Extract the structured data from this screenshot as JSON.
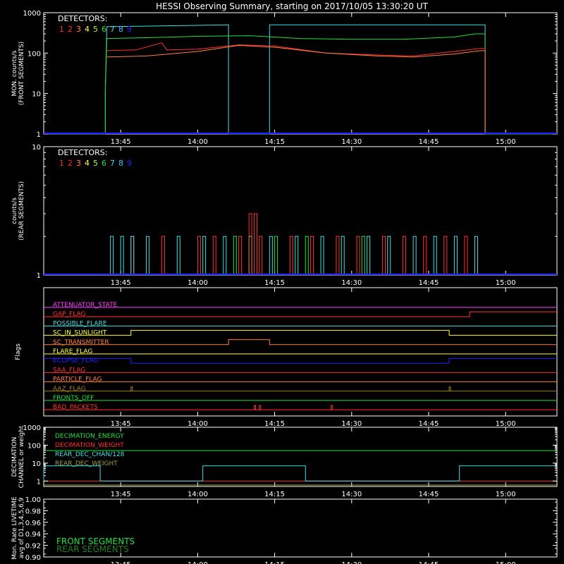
{
  "title": "HESSI Observing Summary, starting on 2017/10/05 13:30:20 UT",
  "time_ticks": [
    "13:45",
    "14:00",
    "14:15",
    "14:30",
    "14:45",
    "15:00"
  ],
  "detectors": {
    "heading": "DETECTORS:",
    "items": [
      {
        "label": "1",
        "color": "#ff3030"
      },
      {
        "label": "2",
        "color": "#ff2020"
      },
      {
        "label": "3",
        "color": "#ff8040"
      },
      {
        "label": "4",
        "color": "#ffff40"
      },
      {
        "label": "5",
        "color": "#a0ff40"
      },
      {
        "label": "6",
        "color": "#20e040"
      },
      {
        "label": "7",
        "color": "#40e0e0"
      },
      {
        "label": "8",
        "color": "#40c0ff"
      },
      {
        "label": "9",
        "color": "#2020ff"
      }
    ]
  },
  "chart_data": [
    {
      "type": "line",
      "name": "front-segment-rates",
      "ylabel": "MON. counts/s (FRONT SEGMENTS)",
      "ylabel_lines": [
        "MON. counts/s",
        "(FRONT SEGMENTS)"
      ],
      "yscale": "log",
      "ylim": [
        1,
        1000
      ],
      "yticks": [
        "1",
        "10",
        "100",
        "1000"
      ],
      "xlim_minutes": [
        0,
        100
      ],
      "series": [
        {
          "color": "#40e0e0",
          "points": [
            [
              0,
              1
            ],
            [
              12,
              1
            ],
            [
              12,
              12
            ],
            [
              12.3,
              450
            ],
            [
              36,
              500
            ],
            [
              36,
              1
            ],
            [
              44,
              1
            ],
            [
              44,
              500
            ],
            [
              86,
              500
            ],
            [
              86,
              1
            ],
            [
              100,
              1
            ]
          ]
        },
        {
          "color": "#20e040",
          "points": [
            [
              12,
              1
            ],
            [
              12,
              12
            ],
            [
              12.3,
              230
            ],
            [
              20,
              240
            ],
            [
              30,
              260
            ],
            [
              40,
              270
            ],
            [
              50,
              230
            ],
            [
              60,
              220
            ],
            [
              70,
              220
            ],
            [
              80,
              250
            ],
            [
              84,
              300
            ],
            [
              86,
              300
            ],
            [
              86,
              1
            ],
            [
              100,
              1
            ]
          ]
        },
        {
          "color": "#ff3030",
          "points": [
            [
              12.3,
              115
            ],
            [
              18,
              120
            ],
            [
              23,
              180
            ],
            [
              24,
              120
            ],
            [
              30,
              125
            ],
            [
              38,
              160
            ],
            [
              45,
              150
            ],
            [
              55,
              100
            ],
            [
              65,
              90
            ],
            [
              72,
              85
            ],
            [
              80,
              110
            ],
            [
              85,
              130
            ],
            [
              86,
              130
            ],
            [
              86,
              1
            ]
          ]
        },
        {
          "color": "#ff8040",
          "points": [
            [
              12.3,
              80
            ],
            [
              20,
              85
            ],
            [
              30,
              110
            ],
            [
              38,
              155
            ],
            [
              45,
              140
            ],
            [
              55,
              100
            ],
            [
              65,
              85
            ],
            [
              72,
              80
            ],
            [
              80,
              95
            ],
            [
              85,
              115
            ],
            [
              86,
              115
            ],
            [
              86,
              1
            ]
          ]
        }
      ]
    },
    {
      "type": "line",
      "name": "rear-segment-rates",
      "ylabel": "counts/s (REAR SEGMENTS)",
      "ylabel_lines": [
        "counts/s",
        "(REAR SEGMENTS)"
      ],
      "yscale": "log",
      "ylim": [
        1,
        10
      ],
      "yticks": [
        "1",
        "10"
      ],
      "xlim_minutes": [
        0,
        100
      ],
      "spikes": [
        {
          "color": "#ff3030",
          "level": 2,
          "times": [
            17,
            23,
            30,
            33,
            38,
            42,
            48,
            52,
            57,
            61,
            66,
            70,
            74,
            78,
            82
          ]
        },
        {
          "color": "#40e0e0",
          "level": 2,
          "times": [
            13,
            15,
            17,
            20,
            26,
            31,
            35,
            40,
            44,
            49,
            54,
            58,
            63,
            67,
            72,
            76,
            80,
            84
          ]
        },
        {
          "color": "#20e040",
          "level": 2,
          "times": [
            37,
            40,
            45,
            51,
            62
          ]
        },
        {
          "color": "#ff3030",
          "level": 3,
          "times": [
            40,
            41
          ]
        }
      ]
    },
    {
      "type": "line",
      "name": "flags",
      "ylabel": "Flags",
      "xlim_minutes": [
        0,
        100
      ],
      "flags": [
        {
          "name": "ATTENUATOR_STATE",
          "color": "#ff40ff",
          "segments": [
            [
              0,
              0
            ]
          ]
        },
        {
          "name": "GAP_FLAG",
          "color": "#ff3030",
          "segments": [
            [
              0,
              0
            ],
            [
              83,
              1
            ]
          ]
        },
        {
          "name": "POSSIBLE_FLARE",
          "color": "#40e0e0",
          "segments": [
            [
              0,
              0
            ]
          ]
        },
        {
          "name": "SC_IN_SUNLIGHT",
          "color": "#ffff40",
          "segments": [
            [
              0,
              0
            ],
            [
              17,
              1
            ],
            [
              79,
              0
            ]
          ]
        },
        {
          "name": "SC_TRANSMITTER",
          "color": "#ff8040",
          "segments": [
            [
              0,
              0
            ],
            [
              36,
              1
            ],
            [
              44,
              0
            ]
          ]
        },
        {
          "name": "FLARE_FLAG",
          "color": "#ffff40",
          "segments": [
            [
              0,
              0
            ]
          ]
        },
        {
          "name": "ECLIPSE_FLAG",
          "color": "#2020ff",
          "segments": [
            [
              0,
              1
            ],
            [
              17,
              0
            ],
            [
              79,
              1
            ]
          ]
        },
        {
          "name": "SAA_FLAG",
          "color": "#ff3030",
          "segments": [
            [
              0,
              0
            ]
          ]
        },
        {
          "name": "PARTICLE_FLAG",
          "color": "#ff8040",
          "segments": [
            [
              0,
              0
            ]
          ]
        },
        {
          "name": "AAZ_FLAG",
          "color": "#a08020",
          "segments": [
            [
              0,
              0
            ]
          ],
          "spikes": [
            17,
            79
          ]
        },
        {
          "name": "FRONTS_OFF",
          "color": "#20e040",
          "segments": [
            [
              0,
              0
            ]
          ]
        },
        {
          "name": "BAD_PACKETS",
          "color": "#ff3030",
          "segments": [
            [
              0,
              0
            ]
          ],
          "spikes": [
            41,
            42,
            56
          ]
        }
      ]
    },
    {
      "type": "line",
      "name": "decimation",
      "ylabel": "DECIMATION CHANNEL or weight",
      "ylabel_lines": [
        "DECIMATION",
        "CHANNEL or weight"
      ],
      "yscale": "log",
      "ylim": [
        0.5,
        1000
      ],
      "yticks": [
        "1",
        "10",
        "100",
        "1000"
      ],
      "xlim_minutes": [
        0,
        100
      ],
      "legend": [
        {
          "label": "DECIMATION_ENERGY",
          "color": "#20e040"
        },
        {
          "label": "DECIMATION_WEIGHT",
          "color": "#ff3030"
        },
        {
          "label": "REAR_DEC_CHAN/128",
          "color": "#40e0e0"
        },
        {
          "label": "REAR_DEC_WEIGHT",
          "color": "#a0a040"
        }
      ],
      "series": [
        {
          "color": "#20e040",
          "points": [
            [
              0,
              50
            ],
            [
              100,
              50
            ]
          ]
        },
        {
          "color": "#ff3030",
          "points": [
            [
              0,
              1
            ],
            [
              100,
              1
            ]
          ]
        },
        {
          "color": "#40e0e0",
          "points": [
            [
              0,
              1
            ],
            [
              0,
              7
            ],
            [
              11,
              7
            ],
            [
              11,
              1
            ],
            [
              31,
              1
            ],
            [
              31,
              7
            ],
            [
              51,
              7
            ],
            [
              51,
              1
            ],
            [
              81,
              1
            ],
            [
              81,
              7
            ],
            [
              100,
              7
            ]
          ]
        },
        {
          "color": "#a0a040",
          "points": [
            [
              0,
              0.6
            ],
            [
              100,
              0.6
            ]
          ]
        }
      ]
    },
    {
      "type": "line",
      "name": "livetime",
      "ylabel": "Mon. Rate LIVETIME avg of D1,3,4,5,6,9",
      "ylabel_lines": [
        "Mon. Rate LIVETIME",
        "avg of D1,3,4,5,6,9"
      ],
      "ylim": [
        0.9,
        1.0
      ],
      "yticks": [
        "0.90",
        "0.92",
        "0.94",
        "0.96",
        "0.98",
        "1.00"
      ],
      "xlim_minutes": [
        0,
        100
      ],
      "legend": [
        {
          "label": "FRONT SEGMENTS",
          "color": "#20e040"
        },
        {
          "label": "REAR SEGMENTS",
          "color": "#208020"
        }
      ],
      "series": []
    }
  ]
}
